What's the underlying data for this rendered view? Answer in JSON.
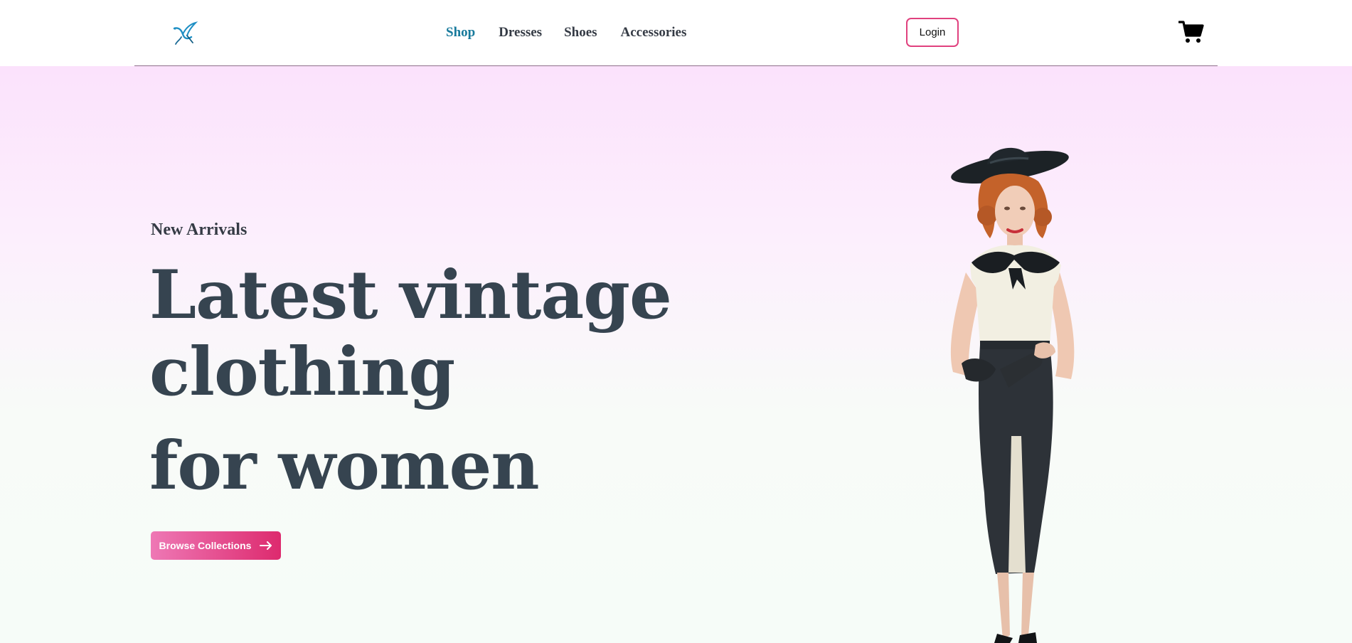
{
  "header": {
    "logo_icon": "hummingbird-logo-icon",
    "nav": [
      {
        "label": "Shop",
        "active": true
      },
      {
        "label": "Dresses",
        "active": false
      },
      {
        "label": "Shoes",
        "active": false
      },
      {
        "label": "Accessories",
        "active": false
      }
    ],
    "login_label": "Login",
    "cart_icon": "shopping-cart-icon"
  },
  "hero": {
    "eyebrow": "New Arrivals",
    "headline_line1": "Latest vintage",
    "headline_line2": "clothing",
    "headline_line3": "for women",
    "cta_label": "Browse Collections",
    "cta_icon": "arrow-right-icon",
    "image_icon": "vintage-dress-model-image"
  },
  "colors": {
    "accent_pink": "#dd2a6e",
    "nav_active": "#177a9c",
    "text_dark": "#364450",
    "hero_top": "#fbe2fc",
    "hero_bottom": "#f6fcf8"
  }
}
